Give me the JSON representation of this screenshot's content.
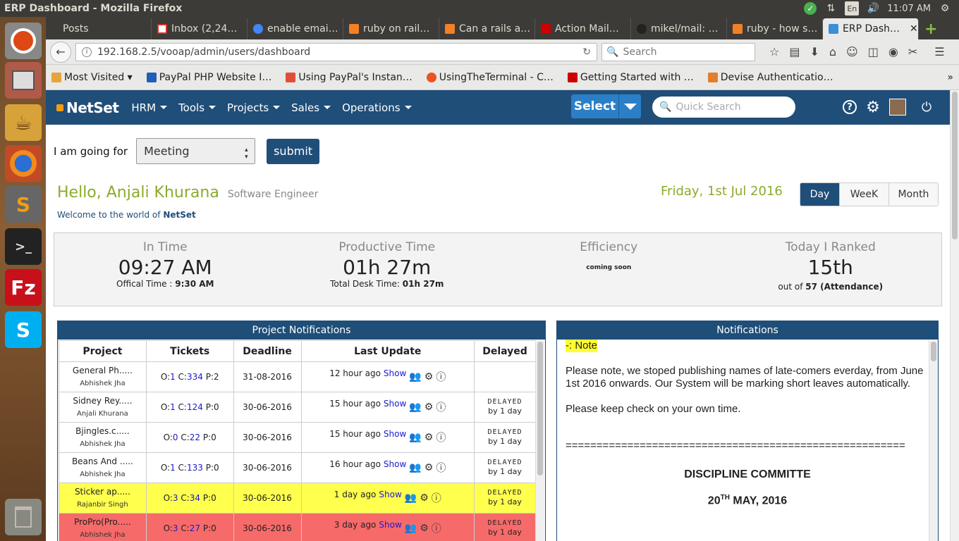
{
  "os": {
    "window_title": "ERP Dashboard - Mozilla Firefox",
    "lang": "En",
    "time": "11:07 AM"
  },
  "tabs": [
    {
      "label": "Posts",
      "color": "#3c3b37"
    },
    {
      "label": "Inbox (2,24…",
      "color": "#d93025"
    },
    {
      "label": "enable emai…",
      "color": "#4285f4"
    },
    {
      "label": "ruby on rail…",
      "color": "#f48024"
    },
    {
      "label": "Can a rails a…",
      "color": "#f48024"
    },
    {
      "label": "Action Mail…",
      "color": "#cc0000"
    },
    {
      "label": "mikel/mail: …",
      "color": "#222222"
    },
    {
      "label": "ruby - how s…",
      "color": "#f48024"
    },
    {
      "label": "ERP Dash…",
      "color": "#3a8fd9",
      "active": true
    }
  ],
  "nav": {
    "url": "192.168.2.5/vooap/admin/users/dashboard",
    "search_placeholder": "Search"
  },
  "bookmarks": [
    {
      "label": "Most Visited ▾",
      "color": "#e8a33a"
    },
    {
      "label": "PayPal PHP Website I…",
      "color": "#1f5fb8"
    },
    {
      "label": "Using PayPal's Instan…",
      "color": "#e04e39"
    },
    {
      "label": "UsingTheTerminal - C…",
      "color": "#e95420"
    },
    {
      "label": "Getting Started with …",
      "color": "#cc0000"
    },
    {
      "label": "Devise Authenticatio…",
      "color": "#e27e2c"
    }
  ],
  "app": {
    "logo": "NetSet",
    "menu": [
      "HRM",
      "Tools",
      "Projects",
      "Sales",
      "Operations"
    ],
    "select_label": "Select",
    "quick_search_placeholder": "Quick Search"
  },
  "going": {
    "label": "I am going for",
    "value": "Meeting",
    "submit": "submit"
  },
  "user": {
    "greeting": "Hello, Anjali Khurana",
    "role": "Software Engineer",
    "welcome_prefix": "Welcome to the world of",
    "welcome_brand": "NetSet",
    "date": "Friday, 1st Jul 2016"
  },
  "period_tabs": [
    "Day",
    "WeeK",
    "Month"
  ],
  "stats": {
    "in_time": {
      "label": "In Time",
      "value": "09:27 AM",
      "sub_label": "Offical Time :",
      "sub_value": "9:30 AM"
    },
    "productive": {
      "label": "Productive Time",
      "value": "01h 27m",
      "sub_label": "Total Desk Time:",
      "sub_value": "01h 27m"
    },
    "efficiency": {
      "label": "Efficiency",
      "note": "coming soon"
    },
    "rank": {
      "label": "Today I Ranked",
      "value": "15th",
      "sub_prefix": "out of",
      "sub_value": "57 (Attendance)"
    }
  },
  "project_panel": {
    "title": "Project Notifications",
    "headers": [
      "Project",
      "Tickets",
      "Deadline",
      "Last Update",
      "Delayed"
    ],
    "rows": [
      {
        "name": "General Ph.....",
        "owner": "Abhishek Jha",
        "o": "1",
        "c": "334",
        "p": "2",
        "deadline": "31-08-2016",
        "ago": "12 hour ago",
        "delayed": "",
        "delay_by": "",
        "hl": ""
      },
      {
        "name": "Sidney Rey.....",
        "owner": "Anjali Khurana",
        "o": "1",
        "c": "124",
        "p": "0",
        "deadline": "30-06-2016",
        "ago": "15 hour ago",
        "delayed": "DELAYED",
        "delay_by": "by 1 day",
        "hl": ""
      },
      {
        "name": "Bjingles.c.....",
        "owner": "Abhishek Jha",
        "o": "0",
        "c": "22",
        "p": "0",
        "deadline": "30-06-2016",
        "ago": "15 hour ago",
        "delayed": "DELAYED",
        "delay_by": "by 1 day",
        "hl": ""
      },
      {
        "name": "Beans And .....",
        "owner": "Abhishek Jha",
        "o": "1",
        "c": "133",
        "p": "0",
        "deadline": "30-06-2016",
        "ago": "16 hour ago",
        "delayed": "DELAYED",
        "delay_by": "by 1 day",
        "hl": ""
      },
      {
        "name": "Sticker ap.....",
        "owner": "Rajanbir Singh",
        "o": "3",
        "c": "34",
        "p": "0",
        "deadline": "30-06-2016",
        "ago": "1 day ago",
        "delayed": "DELAYED",
        "delay_by": "by 1 day",
        "hl": "yel"
      },
      {
        "name": "ProPro(Pro.....",
        "owner": "Abhishek Jha",
        "o": "3",
        "c": "27",
        "p": "0",
        "deadline": "30-06-2016",
        "ago": "3 day ago",
        "delayed": "DELAYED",
        "delay_by": "by 1 day",
        "hl": "red"
      }
    ],
    "show_label": "Show"
  },
  "notif_panel": {
    "title": "Notifications",
    "note_heading": "-: Note",
    "para1": "Please note, we stoped publishing names of late-comers everday, from June 1st 2016 onwards.  Our System will be marking short leaves automatically.",
    "para2": "Please keep check on your own time.",
    "divider": "=======================================================",
    "committee": "DISCIPLINE COMMITTE",
    "date_day": "20",
    "date_sup": "TH",
    "date_rest": " MAY, 2016"
  }
}
